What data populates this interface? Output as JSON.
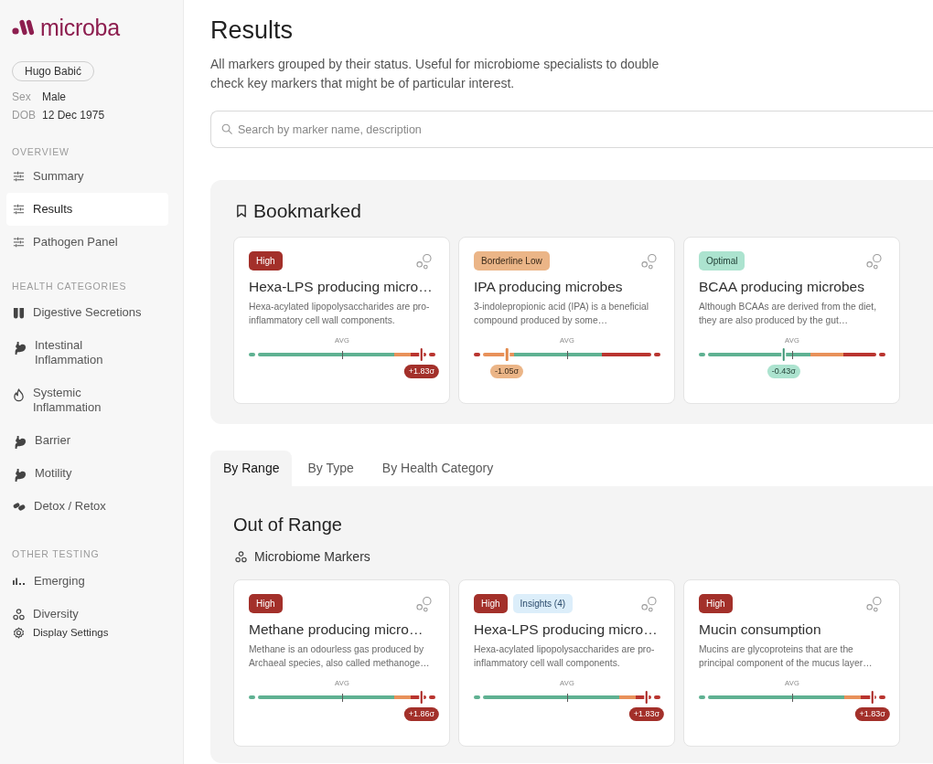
{
  "sidebar": {
    "logo": "microba",
    "patient": {
      "name": "Hugo Babić",
      "fields": [
        {
          "label": "Sex",
          "value": "Male"
        },
        {
          "label": "DOB",
          "value": "12 Dec 1975"
        }
      ]
    },
    "sections": [
      {
        "heading": "OVERVIEW",
        "items": [
          {
            "label": "Summary",
            "selected": false
          },
          {
            "label": "Results",
            "selected": true
          },
          {
            "label": "Pathogen Panel",
            "selected": false
          }
        ]
      },
      {
        "heading": "HEALTH CATEGORIES",
        "items": [
          {
            "label": "Digestive Secretions",
            "selected": false
          },
          {
            "label": "Intestinal Inflammation",
            "selected": false
          },
          {
            "label": "Systemic Inflammation",
            "selected": false
          },
          {
            "label": "Barrier",
            "selected": false
          },
          {
            "label": "Motility",
            "selected": false
          },
          {
            "label": "Detox / Retox",
            "selected": false
          }
        ]
      },
      {
        "heading": "OTHER TESTING",
        "items": [
          {
            "label": "Emerging",
            "selected": false
          },
          {
            "label": "Diversity",
            "selected": false
          }
        ]
      }
    ],
    "settings_link": "Display Settings"
  },
  "header": {
    "title": "Results",
    "description": "All markers grouped by their status. Useful for microbiome specialists to double check key markers that might be of particular interest."
  },
  "search": {
    "placeholder": "Search by marker name, description"
  },
  "bookmarked": {
    "title": "Bookmarked",
    "cards": [
      {
        "badges": [
          {
            "kind": "high",
            "label": "High"
          }
        ],
        "title": "Hexa-LPS producing micro…",
        "description": "Hexa-acylated lipopolysaccharides are pro-inflammatory cell wall components.",
        "scale": {
          "tick_label": "AVG",
          "kind": "high",
          "start_cap": {
            "color": "#5fb192"
          },
          "bands": [
            {
              "color": "#5fb192"
            },
            {
              "color": "#e8915a"
            },
            {
              "color": "#b9342f"
            }
          ],
          "end_cap": {
            "color": "#b9342f"
          },
          "level": 0.926,
          "reading": "+1.83σ"
        }
      },
      {
        "badges": [
          {
            "kind": "borderline",
            "label": "Borderline Low"
          }
        ],
        "title": "IPA producing microbes",
        "description": "3-indolepropionic acid (IPA) is a beneficial compound produced by some…",
        "scale": {
          "tick_label": "AVG",
          "kind": "borderline",
          "start_cap": {
            "color": "#b9342f"
          },
          "bands": [
            {
              "color": "#e8915a"
            },
            {
              "color": "#5fb192"
            },
            {
              "color": "#b9342f"
            }
          ],
          "end_cap": {
            "color": "#b9342f"
          },
          "level": 0.177,
          "reading": "-1.05σ"
        }
      },
      {
        "badges": [
          {
            "kind": "optimal",
            "label": "Optimal"
          }
        ],
        "title": "BCAA producing microbes",
        "description": "Although BCAAs are derived from the diet, they are also produced by the gut…",
        "scale": {
          "tick_label": "AVG",
          "kind": "optimal",
          "start_cap": {
            "color": "#5fb192"
          },
          "bands": [
            {
              "color": "#5fb192"
            },
            {
              "color": "#e8915a"
            },
            {
              "color": "#b9342f"
            }
          ],
          "end_cap": {
            "color": "#b9342f"
          },
          "level": 0.455,
          "reading": "-0.43σ"
        }
      }
    ]
  },
  "tabs": [
    {
      "label": "By Range",
      "selected": true
    },
    {
      "label": "By Type",
      "selected": false
    },
    {
      "label": "By Health Category",
      "selected": false
    }
  ],
  "out_of_range": {
    "title": "Out of Range",
    "groups": [
      {
        "title": "Microbiome Markers",
        "cards": [
          {
            "badges": [
              {
                "kind": "high",
                "label": "High"
              }
            ],
            "title": "Methane producing micro…",
            "description": "Methane is an odourless gas produced by Archaeal species, also called methanoge…",
            "scale": {
              "tick_label": "AVG",
              "kind": "high",
              "start_cap": {
                "color": "#5fb192"
              },
              "bands": [
                {
                  "color": "#5fb192"
                },
                {
                  "color": "#e8915a"
                },
                {
                  "color": "#b9342f"
                }
              ],
              "end_cap": {
                "color": "#b9342f"
              },
              "level": 0.926,
              "reading": "+1.86σ"
            }
          },
          {
            "badges": [
              {
                "kind": "high",
                "label": "High"
              },
              {
                "kind": "insights",
                "label": "Insights (4)"
              }
            ],
            "title": "Hexa-LPS producing micro…",
            "description": "Hexa-acylated lipopolysaccharides are pro-inflammatory cell wall components.",
            "scale": {
              "tick_label": "AVG",
              "kind": "high",
              "start_cap": {
                "color": "#5fb192"
              },
              "bands": [
                {
                  "color": "#5fb192"
                },
                {
                  "color": "#e8915a"
                },
                {
                  "color": "#b9342f"
                }
              ],
              "end_cap": {
                "color": "#b9342f"
              },
              "level": 0.926,
              "reading": "+1.83σ"
            }
          },
          {
            "badges": [
              {
                "kind": "high",
                "label": "High"
              }
            ],
            "title": "Mucin consumption",
            "description": "Mucins are glycoproteins that are the principal component of the mucus layer…",
            "scale": {
              "tick_label": "AVG",
              "kind": "high",
              "start_cap": {
                "color": "#5fb192"
              },
              "bands": [
                {
                  "color": "#5fb192"
                },
                {
                  "color": "#e8915a"
                },
                {
                  "color": "#b9342f"
                }
              ],
              "end_cap": {
                "color": "#b9342f"
              },
              "level": 0.93,
              "reading": "+1.83σ"
            }
          }
        ]
      }
    ]
  }
}
